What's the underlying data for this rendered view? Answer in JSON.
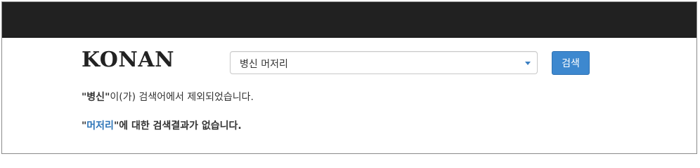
{
  "header": {
    "logo": "KONAN"
  },
  "search": {
    "selected_value": "병신 머저리",
    "button_label": "검색"
  },
  "messages": {
    "excluded": {
      "quote_open": "\"",
      "term": "병신",
      "quote_close": "\"",
      "suffix": "이(가) 검색어에서 제외되었습니다."
    },
    "no_results": {
      "quote_open": "\"",
      "term": "머저리",
      "quote_close": "\"",
      "suffix": "에 대한 검색결과가 없습니다."
    }
  },
  "colors": {
    "topbar": "#212121",
    "button": "#3d88cf",
    "highlight_term": "#2e75b8"
  }
}
